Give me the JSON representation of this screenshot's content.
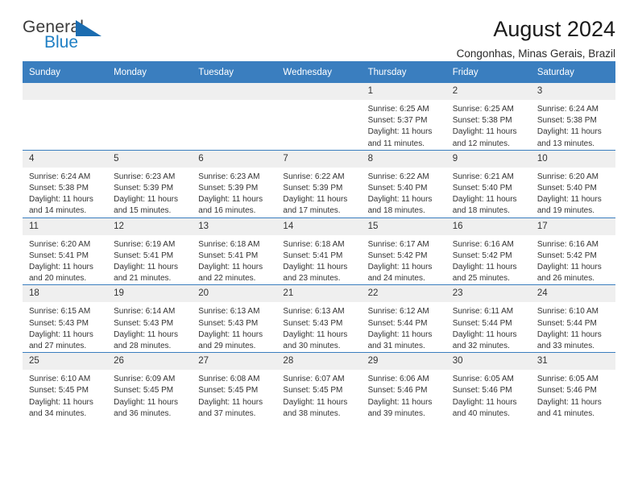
{
  "brand": {
    "name_part1": "General",
    "name_part2": "Blue",
    "logo_icon": "blue-triangle-icon",
    "color_primary": "#1b6cb0",
    "color_blue_text": "#1f7fc4",
    "color_general_text": "#3b3b3b"
  },
  "header": {
    "title": "August 2024",
    "subtitle": "Congonhas, Minas Gerais, Brazil"
  },
  "calendar": {
    "header_bg": "#3a7ebf",
    "header_text_color": "#ffffff",
    "daynum_bg": "#efefef",
    "weekday_headers": [
      "Sunday",
      "Monday",
      "Tuesday",
      "Wednesday",
      "Thursday",
      "Friday",
      "Saturday"
    ],
    "weeks": [
      [
        {
          "day": "",
          "empty": true
        },
        {
          "day": "",
          "empty": true
        },
        {
          "day": "",
          "empty": true
        },
        {
          "day": "",
          "empty": true
        },
        {
          "day": "1",
          "sunrise": "Sunrise: 6:25 AM",
          "sunset": "Sunset: 5:37 PM",
          "daylight_line1": "Daylight: 11 hours",
          "daylight_line2": "and 11 minutes."
        },
        {
          "day": "2",
          "sunrise": "Sunrise: 6:25 AM",
          "sunset": "Sunset: 5:38 PM",
          "daylight_line1": "Daylight: 11 hours",
          "daylight_line2": "and 12 minutes."
        },
        {
          "day": "3",
          "sunrise": "Sunrise: 6:24 AM",
          "sunset": "Sunset: 5:38 PM",
          "daylight_line1": "Daylight: 11 hours",
          "daylight_line2": "and 13 minutes."
        }
      ],
      [
        {
          "day": "4",
          "sunrise": "Sunrise: 6:24 AM",
          "sunset": "Sunset: 5:38 PM",
          "daylight_line1": "Daylight: 11 hours",
          "daylight_line2": "and 14 minutes."
        },
        {
          "day": "5",
          "sunrise": "Sunrise: 6:23 AM",
          "sunset": "Sunset: 5:39 PM",
          "daylight_line1": "Daylight: 11 hours",
          "daylight_line2": "and 15 minutes."
        },
        {
          "day": "6",
          "sunrise": "Sunrise: 6:23 AM",
          "sunset": "Sunset: 5:39 PM",
          "daylight_line1": "Daylight: 11 hours",
          "daylight_line2": "and 16 minutes."
        },
        {
          "day": "7",
          "sunrise": "Sunrise: 6:22 AM",
          "sunset": "Sunset: 5:39 PM",
          "daylight_line1": "Daylight: 11 hours",
          "daylight_line2": "and 17 minutes."
        },
        {
          "day": "8",
          "sunrise": "Sunrise: 6:22 AM",
          "sunset": "Sunset: 5:40 PM",
          "daylight_line1": "Daylight: 11 hours",
          "daylight_line2": "and 18 minutes."
        },
        {
          "day": "9",
          "sunrise": "Sunrise: 6:21 AM",
          "sunset": "Sunset: 5:40 PM",
          "daylight_line1": "Daylight: 11 hours",
          "daylight_line2": "and 18 minutes."
        },
        {
          "day": "10",
          "sunrise": "Sunrise: 6:20 AM",
          "sunset": "Sunset: 5:40 PM",
          "daylight_line1": "Daylight: 11 hours",
          "daylight_line2": "and 19 minutes."
        }
      ],
      [
        {
          "day": "11",
          "sunrise": "Sunrise: 6:20 AM",
          "sunset": "Sunset: 5:41 PM",
          "daylight_line1": "Daylight: 11 hours",
          "daylight_line2": "and 20 minutes."
        },
        {
          "day": "12",
          "sunrise": "Sunrise: 6:19 AM",
          "sunset": "Sunset: 5:41 PM",
          "daylight_line1": "Daylight: 11 hours",
          "daylight_line2": "and 21 minutes."
        },
        {
          "day": "13",
          "sunrise": "Sunrise: 6:18 AM",
          "sunset": "Sunset: 5:41 PM",
          "daylight_line1": "Daylight: 11 hours",
          "daylight_line2": "and 22 minutes."
        },
        {
          "day": "14",
          "sunrise": "Sunrise: 6:18 AM",
          "sunset": "Sunset: 5:41 PM",
          "daylight_line1": "Daylight: 11 hours",
          "daylight_line2": "and 23 minutes."
        },
        {
          "day": "15",
          "sunrise": "Sunrise: 6:17 AM",
          "sunset": "Sunset: 5:42 PM",
          "daylight_line1": "Daylight: 11 hours",
          "daylight_line2": "and 24 minutes."
        },
        {
          "day": "16",
          "sunrise": "Sunrise: 6:16 AM",
          "sunset": "Sunset: 5:42 PM",
          "daylight_line1": "Daylight: 11 hours",
          "daylight_line2": "and 25 minutes."
        },
        {
          "day": "17",
          "sunrise": "Sunrise: 6:16 AM",
          "sunset": "Sunset: 5:42 PM",
          "daylight_line1": "Daylight: 11 hours",
          "daylight_line2": "and 26 minutes."
        }
      ],
      [
        {
          "day": "18",
          "sunrise": "Sunrise: 6:15 AM",
          "sunset": "Sunset: 5:43 PM",
          "daylight_line1": "Daylight: 11 hours",
          "daylight_line2": "and 27 minutes."
        },
        {
          "day": "19",
          "sunrise": "Sunrise: 6:14 AM",
          "sunset": "Sunset: 5:43 PM",
          "daylight_line1": "Daylight: 11 hours",
          "daylight_line2": "and 28 minutes."
        },
        {
          "day": "20",
          "sunrise": "Sunrise: 6:13 AM",
          "sunset": "Sunset: 5:43 PM",
          "daylight_line1": "Daylight: 11 hours",
          "daylight_line2": "and 29 minutes."
        },
        {
          "day": "21",
          "sunrise": "Sunrise: 6:13 AM",
          "sunset": "Sunset: 5:43 PM",
          "daylight_line1": "Daylight: 11 hours",
          "daylight_line2": "and 30 minutes."
        },
        {
          "day": "22",
          "sunrise": "Sunrise: 6:12 AM",
          "sunset": "Sunset: 5:44 PM",
          "daylight_line1": "Daylight: 11 hours",
          "daylight_line2": "and 31 minutes."
        },
        {
          "day": "23",
          "sunrise": "Sunrise: 6:11 AM",
          "sunset": "Sunset: 5:44 PM",
          "daylight_line1": "Daylight: 11 hours",
          "daylight_line2": "and 32 minutes."
        },
        {
          "day": "24",
          "sunrise": "Sunrise: 6:10 AM",
          "sunset": "Sunset: 5:44 PM",
          "daylight_line1": "Daylight: 11 hours",
          "daylight_line2": "and 33 minutes."
        }
      ],
      [
        {
          "day": "25",
          "sunrise": "Sunrise: 6:10 AM",
          "sunset": "Sunset: 5:45 PM",
          "daylight_line1": "Daylight: 11 hours",
          "daylight_line2": "and 34 minutes."
        },
        {
          "day": "26",
          "sunrise": "Sunrise: 6:09 AM",
          "sunset": "Sunset: 5:45 PM",
          "daylight_line1": "Daylight: 11 hours",
          "daylight_line2": "and 36 minutes."
        },
        {
          "day": "27",
          "sunrise": "Sunrise: 6:08 AM",
          "sunset": "Sunset: 5:45 PM",
          "daylight_line1": "Daylight: 11 hours",
          "daylight_line2": "and 37 minutes."
        },
        {
          "day": "28",
          "sunrise": "Sunrise: 6:07 AM",
          "sunset": "Sunset: 5:45 PM",
          "daylight_line1": "Daylight: 11 hours",
          "daylight_line2": "and 38 minutes."
        },
        {
          "day": "29",
          "sunrise": "Sunrise: 6:06 AM",
          "sunset": "Sunset: 5:46 PM",
          "daylight_line1": "Daylight: 11 hours",
          "daylight_line2": "and 39 minutes."
        },
        {
          "day": "30",
          "sunrise": "Sunrise: 6:05 AM",
          "sunset": "Sunset: 5:46 PM",
          "daylight_line1": "Daylight: 11 hours",
          "daylight_line2": "and 40 minutes."
        },
        {
          "day": "31",
          "sunrise": "Sunrise: 6:05 AM",
          "sunset": "Sunset: 5:46 PM",
          "daylight_line1": "Daylight: 11 hours",
          "daylight_line2": "and 41 minutes."
        }
      ]
    ]
  }
}
